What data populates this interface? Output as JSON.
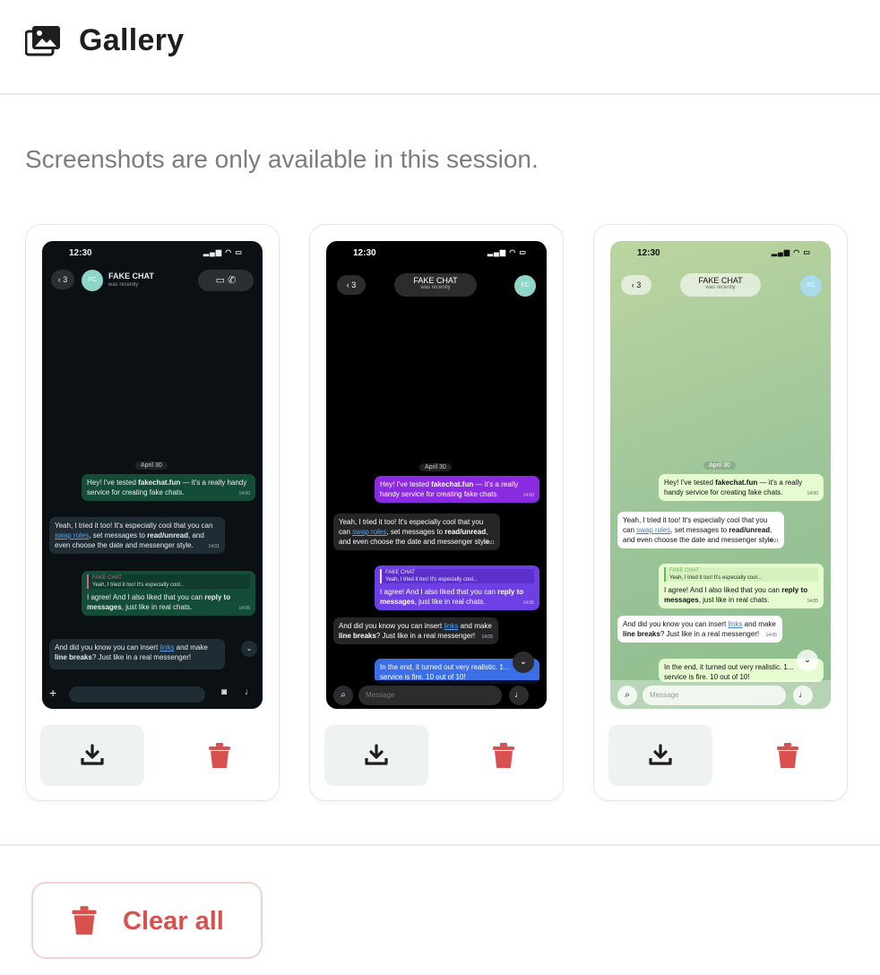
{
  "header": {
    "title": "Gallery",
    "icon": "gallery-icon"
  },
  "note": "Screenshots are only available in this session.",
  "colors": {
    "accent_red": "#d9514e",
    "download_bg": "#eef2f1",
    "text_muted": "#7a7d80"
  },
  "screenshots": [
    {
      "style": "whatsapp-dark",
      "time": "12:30",
      "back_count": "3",
      "avatar": "FC",
      "contact": "FAKE CHAT",
      "status": "was recently",
      "date": "April 30",
      "msg1": {
        "pre": "Hey! I've tested ",
        "bold": "fakechat.fun",
        "post": " — it's a really handy service for creating fake chats.",
        "time": "14:00"
      },
      "msg2": {
        "pre": "Yeah, I tried it too! It's especially cool that you can ",
        "link": "swap roles",
        "mid": ", set messages to ",
        "bold": "read/unread",
        "post": ", and even choose the date and messenger style.",
        "time": "14:01"
      },
      "msg3": {
        "quote_name": "FAKE CHAT",
        "quote_text": "Yeah, I tried it too! It's especially cool...",
        "pre": "I agree! And I also liked that you can ",
        "bold": "reply to messages",
        "post": ", just like in real chats.",
        "time": "14:05"
      },
      "msg4": {
        "pre": "And did you know you can insert ",
        "link": "links",
        "mid": " and make ",
        "bold": "line breaks",
        "post": "? Just like in a real messenger!"
      },
      "input_placeholder": ""
    },
    {
      "style": "telegram-dark",
      "time": "12:30",
      "back_count": "3",
      "avatar": "FC",
      "contact": "FAKE CHAT",
      "status": "was recently",
      "date": "April 30",
      "msg1": {
        "pre": "Hey! I've tested ",
        "bold": "fakechat.fun",
        "post": " — it's a really handy service for creating fake chats.",
        "time": "14:00"
      },
      "msg2": {
        "pre": "Yeah, I tried it too! It's especially cool that you can ",
        "link": "swap roles",
        "mid": ", set messages to ",
        "bold": "read/unread",
        "post": ", and even choose the date and messenger style.",
        "time": "14:01"
      },
      "msg3": {
        "quote_name": "FAKE CHAT",
        "quote_text": "Yeah, I tried it too! It's especially cool...",
        "pre": "I agree! And I also liked that you can ",
        "bold": "reply to messages",
        "post": ", just like in real chats.",
        "time": "14:05"
      },
      "msg4": {
        "pre": "And did you know you can insert ",
        "link": "links",
        "mid": " and make ",
        "bold": "line breaks",
        "post": "? Just like in a real messenger!",
        "time": "14:05"
      },
      "msg5": "In the end, it turned out very realistic. 1... service is fire. 10 out of 10!",
      "input_placeholder": "Message"
    },
    {
      "style": "telegram-light",
      "time": "12:30",
      "back_count": "3",
      "avatar": "FC",
      "contact": "FAKE CHAT",
      "status": "was recently",
      "date": "April 30",
      "msg1": {
        "pre": "Hey! I've tested ",
        "bold": "fakechat.fun",
        "post": " — it's a really handy service for creating fake chats.",
        "time": "14:00"
      },
      "msg2": {
        "pre": "Yeah, I tried it too! It's especially cool that you can ",
        "link": "swap roles",
        "mid": ", set messages to ",
        "bold": "read/unread",
        "post": ", and even choose the date and messenger style.",
        "time": "14:01"
      },
      "msg3": {
        "quote_name": "FAKE CHAT",
        "quote_text": "Yeah, I tried it too! It's especially cool...",
        "pre": "I agree! And I also liked that you can ",
        "bold": "reply to messages",
        "post": ", just like in real chats.",
        "time": "14:05"
      },
      "msg4": {
        "pre": "And did you know you can insert ",
        "link": "links",
        "mid": " and make ",
        "bold": "line breaks",
        "post": "? Just like in a real messenger!",
        "time": "14:05"
      },
      "msg5": "In the end, it turned out very realistic. 1... service is fire. 10 out of 10!",
      "input_placeholder": "Message"
    }
  ],
  "clear_all_label": "Clear all"
}
